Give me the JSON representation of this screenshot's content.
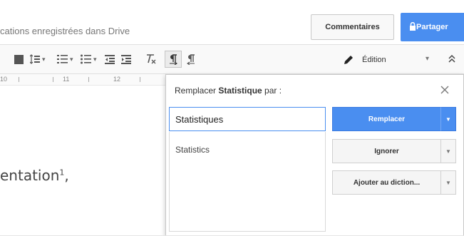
{
  "header": {
    "saved_status": "cations enregistrées dans Drive",
    "comments_label": "Commentaires",
    "share_label": "Partager",
    "share_color": "#4a8ef0"
  },
  "toolbar": {
    "icons": [
      "paragraph-style-icon",
      "line-spacing-icon",
      "numbered-list-icon",
      "bulleted-list-icon",
      "decrease-indent-icon",
      "increase-indent-icon",
      "clear-formatting-icon",
      "ltr-paragraph-icon",
      "rtl-paragraph-icon"
    ],
    "mode_label": "Édition",
    "collapse_icon": "chevron-double-up-icon"
  },
  "ruler": {
    "labels": [
      "10",
      "11",
      "12"
    ]
  },
  "document": {
    "text": "entation",
    "superscript": "1",
    "trailing": ","
  },
  "spellcheck": {
    "title_prefix": "Remplacer ",
    "title_word": "Statistique",
    "title_suffix": " par :",
    "input_value": "Statistiques",
    "suggestions": [
      "Statistics"
    ],
    "replace_label": "Remplacer",
    "ignore_label": "Ignorer",
    "add_label": "Ajouter au diction...",
    "accent_color": "#4a8ef0"
  }
}
